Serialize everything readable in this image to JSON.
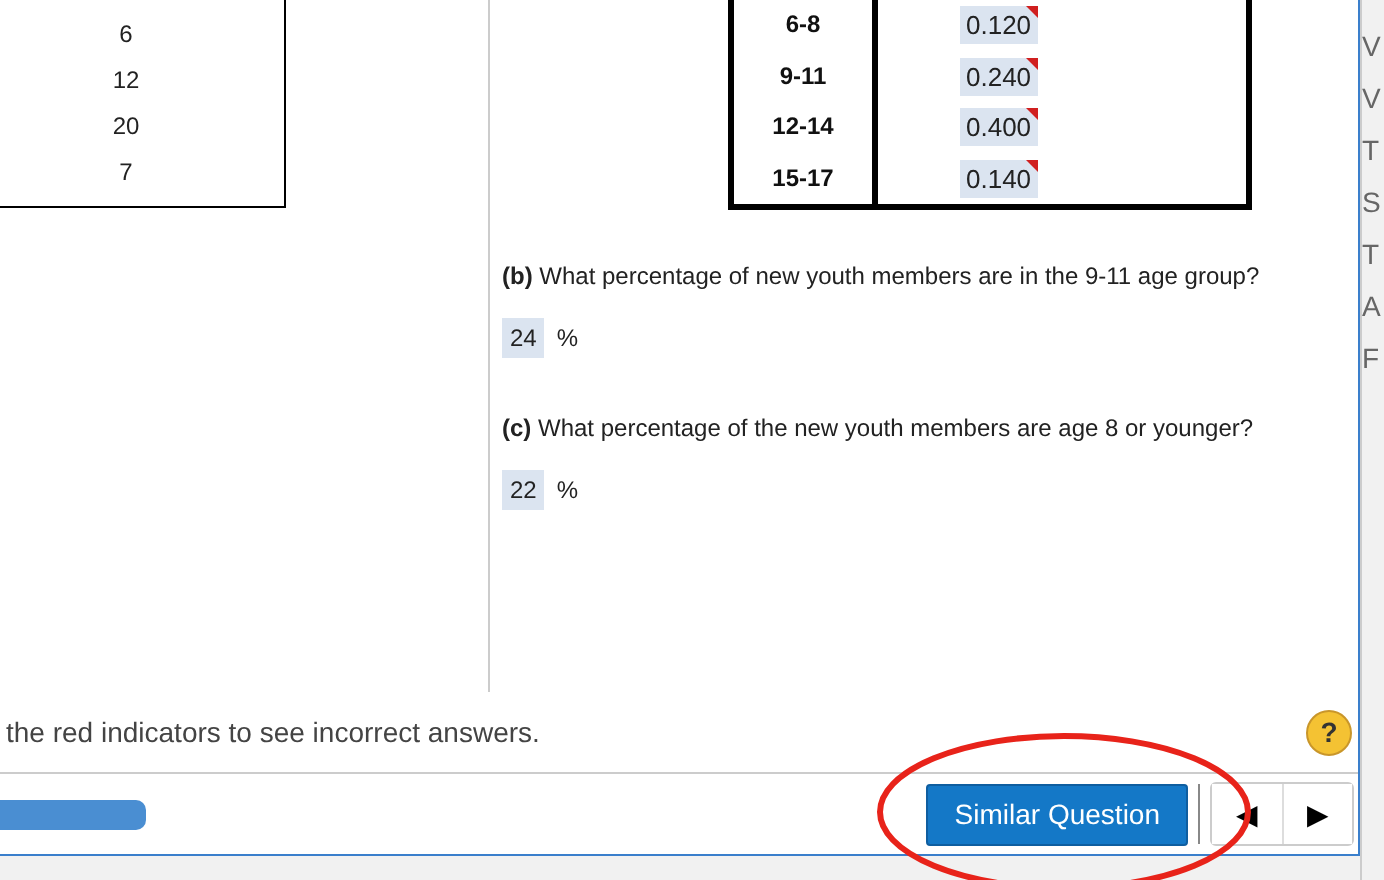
{
  "left_table": {
    "values": [
      "6",
      "12",
      "20",
      "7"
    ]
  },
  "right_table": {
    "rows": [
      {
        "age_group": "6-8",
        "value": "0.120",
        "incorrect": true
      },
      {
        "age_group": "9-11",
        "value": "0.240",
        "incorrect": true
      },
      {
        "age_group": "12-14",
        "value": "0.400",
        "incorrect": true
      },
      {
        "age_group": "15-17",
        "value": "0.140",
        "incorrect": true
      }
    ]
  },
  "questions": [
    {
      "part": "(b)",
      "text": "What percentage of new youth members are in the 9-11 age group?",
      "answer": "24",
      "unit": "%"
    },
    {
      "part": "(c)",
      "text": "What percentage of the new youth members are age 8 or younger?",
      "answer": "22",
      "unit": "%"
    }
  ],
  "side_letters": [
    "V",
    "V",
    "T",
    "S",
    "T",
    "A",
    "F"
  ],
  "footer": {
    "message": "the red indicators to see incorrect answers.",
    "help": "?",
    "similar_button": "Similar Question",
    "prev": "◀",
    "next": "▶"
  }
}
